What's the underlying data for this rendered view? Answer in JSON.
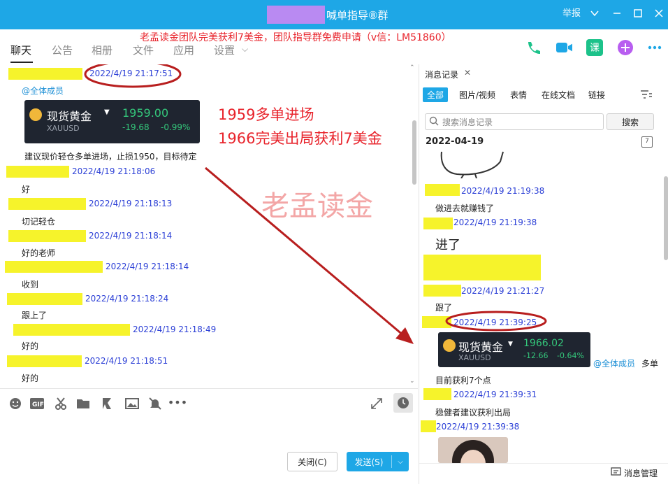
{
  "window": {
    "title": "喊单指导⑧群",
    "controls": {
      "report": "举报"
    }
  },
  "promo_banner": "老孟读金团队完美获利7美金，团队指导群免费申请（v信：LM51860）",
  "tabs": [
    "聊天",
    "公告",
    "相册",
    "文件",
    "应用",
    "设置"
  ],
  "top_icons": {
    "course_label": "课"
  },
  "chat": {
    "first_timestamp": "2022/4/19 21:17:51",
    "mention": "@全体成员",
    "gold_card": {
      "name": "现货黄金",
      "symbol": "XAUUSD",
      "price": "1959.00",
      "change": "-19.68",
      "change_pct": "-0.99%"
    },
    "instruction": "建议现价轻仓多单进场，止损1950，目标待定",
    "messages": [
      {
        "time": "2022/4/19 21:18:06",
        "text": "好"
      },
      {
        "time": "2022/4/19 21:18:13",
        "text": "切记轻仓"
      },
      {
        "time": "2022/4/19 21:18:14",
        "text": "好的老师"
      },
      {
        "time": "2022/4/19 21:18:14",
        "text": "收到"
      },
      {
        "time": "2022/4/19 21:18:24",
        "text": "跟上了"
      },
      {
        "time": "2022/4/19 21:18:49",
        "text": "好的"
      },
      {
        "time": "2022/4/19 21:18:51",
        "text": "好的"
      }
    ],
    "annotations": [
      "1959多单进场",
      "1966完美出局获利7美金"
    ],
    "watermark": "老孟读金"
  },
  "compose": {
    "close_label": "关闭(C)",
    "send_label": "发送(S)"
  },
  "history_panel": {
    "tab": "消息记录",
    "filters": [
      "全部",
      "图片/视频",
      "表情",
      "在线文档",
      "链接"
    ],
    "search_placeholder": "搜索消息记录",
    "search_button": "搜索",
    "date": "2022-04-19",
    "calendar_day": "7",
    "messages": [
      {
        "time": "2022/4/19 21:19:38",
        "text": "做进去就赚钱了"
      },
      {
        "time": "2022/4/19 21:19:38",
        "text": "进了"
      },
      {
        "time": "2022/4/19 21:21:27",
        "text": "跟了"
      },
      {
        "time": "2022/4/19 21:39:25",
        "text": ""
      },
      {
        "time": "2022/4/19 21:39:31",
        "text": "稳健者建议获利出局"
      },
      {
        "time": "2022/4/19 21:39:38",
        "text": ""
      }
    ],
    "gold_card": {
      "name": "现货黄金",
      "symbol": "XAUUSD",
      "price": "1966.02",
      "change": "-12.66",
      "change_pct": "-0.64%"
    },
    "mention_text": "@全体成员",
    "mention_suffix": "多单",
    "profit_text": "目前获利7个点",
    "footer": "消息管理"
  },
  "colors": {
    "accent": "#1ea7e6",
    "redact": "#f6f32b",
    "timestamp": "#2b3fd6",
    "annotation": "#e8232b",
    "price_green": "#34c77b"
  }
}
